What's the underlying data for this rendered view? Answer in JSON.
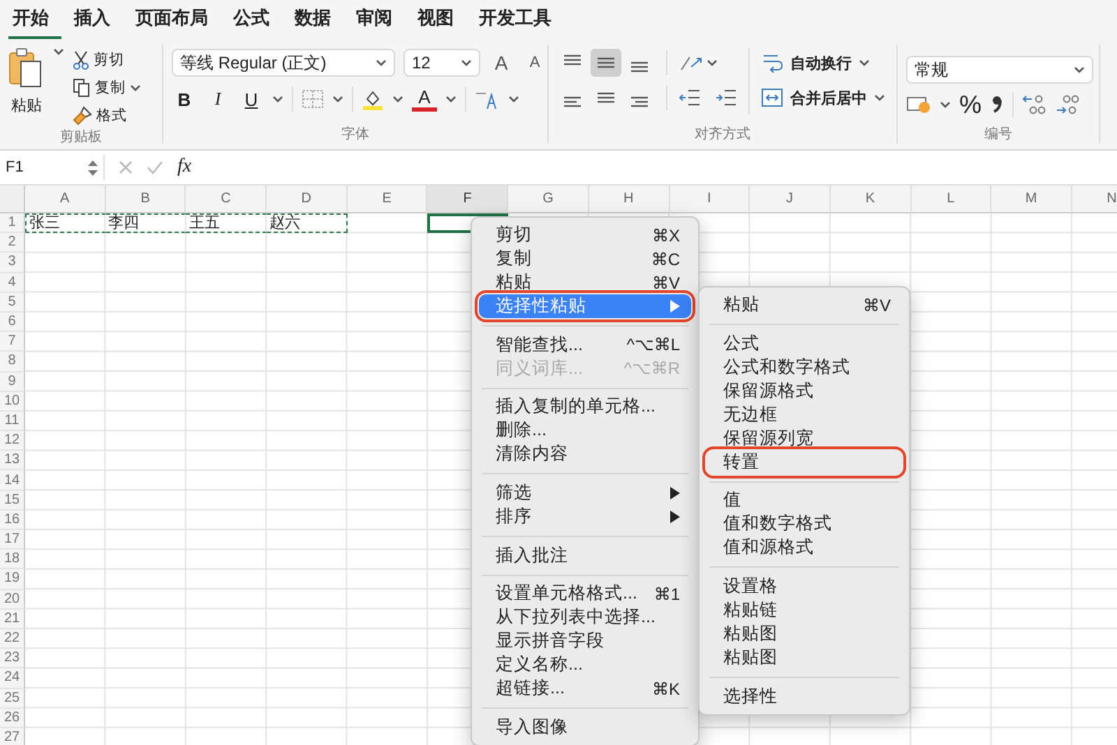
{
  "ribbon_tabs": [
    {
      "label": "开始",
      "selected": true
    },
    {
      "label": "插入",
      "selected": false
    },
    {
      "label": "页面布局",
      "selected": false
    },
    {
      "label": "公式",
      "selected": false
    },
    {
      "label": "数据",
      "selected": false
    },
    {
      "label": "审阅",
      "selected": false
    },
    {
      "label": "视图",
      "selected": false
    },
    {
      "label": "开发工具",
      "selected": false
    }
  ],
  "clipboard_group": {
    "paste": "粘贴",
    "cut": "剪切",
    "copy": "复制",
    "format_painter": "格式",
    "label": "剪贴板"
  },
  "font_group": {
    "font": "等线 Regular (正文)",
    "size": "12",
    "grow": "A",
    "shrink": "A",
    "bold": "B",
    "italic": "I",
    "underline": "U",
    "font_color": "A",
    "label": "字体"
  },
  "alignment_group": {
    "wrap_text": "自动换行",
    "merge_center": "合并后居中",
    "center_selected": true,
    "label": "对齐方式"
  },
  "number_group": {
    "format": "常规",
    "percent": "%",
    "label": "编号"
  },
  "formula_bar": {
    "name_box": "F1",
    "fx": "fx"
  },
  "columns": [
    {
      "label": "A",
      "active": false
    },
    {
      "label": "B",
      "active": false
    },
    {
      "label": "C",
      "active": false
    },
    {
      "label": "D",
      "active": false
    },
    {
      "label": "E",
      "active": false
    },
    {
      "label": "F",
      "active": true
    },
    {
      "label": "G",
      "active": false
    },
    {
      "label": "H",
      "active": false
    },
    {
      "label": "I",
      "active": false
    },
    {
      "label": "J",
      "active": false
    },
    {
      "label": "K",
      "active": false
    },
    {
      "label": "L",
      "active": false
    },
    {
      "label": "M",
      "active": false
    },
    {
      "label": "N",
      "active": false
    }
  ],
  "rows": [
    "1",
    "2",
    "3",
    "4",
    "5",
    "6",
    "7",
    "8",
    "9",
    "10",
    "11",
    "12",
    "13",
    "14",
    "15",
    "16",
    "17",
    "18",
    "19",
    "20",
    "21",
    "22",
    "23",
    "24",
    "25",
    "26",
    "27"
  ],
  "row_1": [
    {
      "text": "张三",
      "copied": true
    },
    {
      "text": "李四",
      "copied": true
    },
    {
      "text": "王五",
      "copied": true
    },
    {
      "text": "赵六",
      "copied": true
    }
  ],
  "context_menu": {
    "groups": [
      {
        "items": [
          {
            "label": "剪切",
            "shortcut": "⌘X",
            "selected": false,
            "disabled": false,
            "submenu": false,
            "annotated": false
          },
          {
            "label": "复制",
            "shortcut": "⌘C",
            "selected": false,
            "disabled": false,
            "submenu": false,
            "annotated": false
          },
          {
            "label": "粘贴",
            "shortcut": "⌘V",
            "selected": false,
            "disabled": false,
            "submenu": false,
            "annotated": false
          },
          {
            "label": "选择性粘贴",
            "selected": true,
            "disabled": false,
            "submenu": true,
            "annotated": true
          }
        ]
      },
      {
        "items": [
          {
            "label": "智能查找...",
            "shortcut": "^⌥⌘L",
            "selected": false,
            "disabled": false,
            "submenu": false,
            "annotated": false
          },
          {
            "label": "同义词库...",
            "shortcut": "^⌥⌘R",
            "selected": false,
            "disabled": true,
            "submenu": false,
            "annotated": false
          }
        ]
      },
      {
        "items": [
          {
            "label": "插入复制的单元格...",
            "selected": false,
            "disabled": false,
            "submenu": false,
            "annotated": false
          },
          {
            "label": "删除...",
            "selected": false,
            "disabled": false,
            "submenu": false,
            "annotated": false
          },
          {
            "label": "清除内容",
            "selected": false,
            "disabled": false,
            "submenu": false,
            "annotated": false
          }
        ]
      },
      {
        "items": [
          {
            "label": "筛选",
            "selected": false,
            "disabled": false,
            "submenu": true,
            "annotated": false
          },
          {
            "label": "排序",
            "selected": false,
            "disabled": false,
            "submenu": true,
            "annotated": false
          }
        ]
      },
      {
        "items": [
          {
            "label": "插入批注",
            "selected": false,
            "disabled": false,
            "submenu": false,
            "annotated": false
          }
        ]
      },
      {
        "items": [
          {
            "label": "设置单元格格式...",
            "shortcut": "⌘1",
            "selected": false,
            "disabled": false,
            "submenu": false,
            "annotated": false
          },
          {
            "label": "从下拉列表中选择...",
            "selected": false,
            "disabled": false,
            "submenu": false,
            "annotated": false
          },
          {
            "label": "显示拼音字段",
            "selected": false,
            "disabled": false,
            "submenu": false,
            "annotated": false
          },
          {
            "label": "定义名称...",
            "selected": false,
            "disabled": false,
            "submenu": false,
            "annotated": false
          },
          {
            "label": "超链接...",
            "shortcut": "⌘K",
            "selected": false,
            "disabled": false,
            "submenu": false,
            "annotated": false
          }
        ]
      },
      {
        "items": [
          {
            "label": "导入图像",
            "selected": false,
            "disabled": false,
            "submenu": false,
            "annotated": false
          }
        ]
      }
    ]
  },
  "paste_special_menu": {
    "groups": [
      {
        "items": [
          {
            "label": "粘贴",
            "shortcut": "⌘V",
            "annotated": false
          }
        ]
      },
      {
        "items": [
          {
            "label": "公式",
            "annotated": false
          },
          {
            "label": "公式和数字格式",
            "annotated": false
          },
          {
            "label": "保留源格式",
            "annotated": false
          },
          {
            "label": "无边框",
            "annotated": false
          },
          {
            "label": "保留源列宽",
            "annotated": false
          },
          {
            "label": "转置",
            "annotated": true
          }
        ]
      },
      {
        "items": [
          {
            "label": "值",
            "annotated": false
          },
          {
            "label": "值和数字格式",
            "annotated": false
          },
          {
            "label": "值和源格式",
            "annotated": false
          }
        ]
      },
      {
        "items": [
          {
            "label": "设置格",
            "annotated": false
          },
          {
            "label": "粘贴链",
            "annotated": false
          },
          {
            "label": "粘贴图",
            "annotated": false
          },
          {
            "label": "粘贴图",
            "annotated": false
          }
        ]
      },
      {
        "items": [
          {
            "label": "选择性",
            "annotated": false
          }
        ]
      }
    ]
  }
}
